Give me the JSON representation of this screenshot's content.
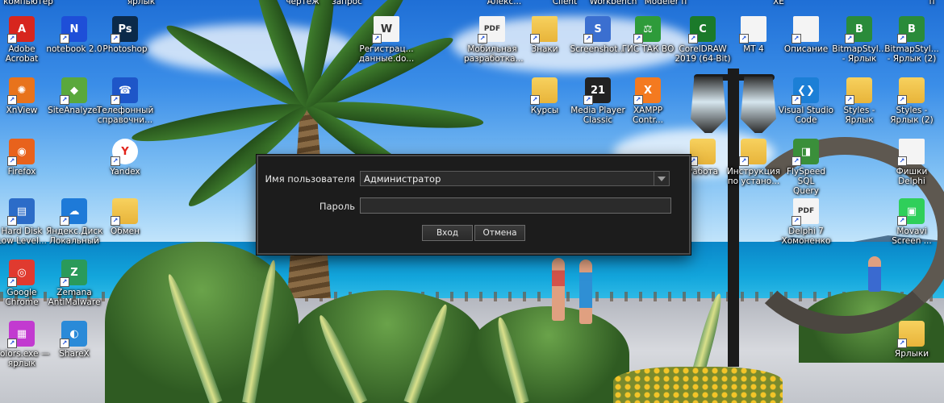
{
  "dialog": {
    "username_label": "Имя пользователя",
    "username_value": "Администратор",
    "password_label": "Пароль",
    "password_value": "",
    "ok_button": "Вход",
    "cancel_button": "Отмена"
  },
  "top_row_partial": [
    "компьютер",
    "ярлык",
    "чертеж",
    "запрос",
    "Алекс...",
    "Client",
    "Workbench",
    "Modeler п",
    "XE",
    "п"
  ],
  "desktop_icons": [
    {
      "label": "Adobe\nAcrobat",
      "icon": "adobe-acrobat-icon",
      "color": "#d7261e",
      "glyph": "A"
    },
    {
      "label": "notebook 2.0",
      "icon": "notebook-icon",
      "color": "#1e4fd8",
      "glyph": "N"
    },
    {
      "label": "Photoshop",
      "icon": "photoshop-icon",
      "color": "#0b2a4a",
      "glyph": "Ps"
    },
    {
      "label": "Регистрац...\nданные.do...",
      "icon": "word-document-icon",
      "color": "#f4f4f4",
      "glyph": "W"
    },
    {
      "label": "Мобильная\nразработка...",
      "icon": "pdf-document-icon",
      "color": "#f4f4f4",
      "glyph": "PDF"
    },
    {
      "label": "Знаки",
      "icon": "folder-icon",
      "color": "#f4f4f4",
      "glyph": ""
    },
    {
      "label": "Screenshot...",
      "icon": "screenshot-icon",
      "color": "#3b6fd0",
      "glyph": "S"
    },
    {
      "label": "ГИС ТАК ВО",
      "icon": "gis-icon",
      "color": "#2e9b3a",
      "glyph": "⚖"
    },
    {
      "label": "CorelDRAW\n2019 (64-Bit)",
      "icon": "coreldraw-icon",
      "color": "#1b7a2a",
      "glyph": "C"
    },
    {
      "label": "МТ 4",
      "icon": "document-icon",
      "color": "#f4f4f4",
      "glyph": ""
    },
    {
      "label": "Описание",
      "icon": "document-icon",
      "color": "#f4f4f4",
      "glyph": ""
    },
    {
      "label": "BitmapStyl...\n- Ярлык",
      "icon": "bitmapstyle-icon",
      "color": "#2a8b3a",
      "glyph": "B"
    },
    {
      "label": "BitmapStyl...\n- Ярлык (2)",
      "icon": "bitmapstyle-icon",
      "color": "#2a8b3a",
      "glyph": "B"
    },
    {
      "label": "XnView",
      "icon": "xnview-icon",
      "color": "#e8731c",
      "glyph": "✺"
    },
    {
      "label": "SiteAnalyzer",
      "icon": "siteanalyzer-icon",
      "color": "#5aa83c",
      "glyph": "◆"
    },
    {
      "label": "Телефонный\nсправочни...",
      "icon": "phone-book-icon",
      "color": "#1e56c8",
      "glyph": "☎"
    },
    {
      "label": "Курсы",
      "icon": "folder-icon",
      "color": "#f0c24a",
      "glyph": ""
    },
    {
      "label": "Media Player\nClassic",
      "icon": "media-player-icon",
      "color": "#222",
      "glyph": "21"
    },
    {
      "label": "XAMPP\nContr...",
      "icon": "xampp-icon",
      "color": "#f47a20",
      "glyph": "X"
    },
    {
      "label": "Visual Studio\nCode",
      "icon": "vscode-icon",
      "color": "#1c7fd6",
      "glyph": "❮❯"
    },
    {
      "label": "Styles -\nЯрлык",
      "icon": "folder-icon",
      "color": "#f0c24a",
      "glyph": ""
    },
    {
      "label": "Styles -\nЯрлык (2)",
      "icon": "folder-icon",
      "color": "#f0c24a",
      "glyph": ""
    },
    {
      "label": "Firefox",
      "icon": "firefox-icon",
      "color": "#e8621c",
      "glyph": "◉"
    },
    {
      "label": "Yandex",
      "icon": "yandex-icon",
      "color": "#ffffff",
      "glyph": "Y"
    },
    {
      "label": "Работа",
      "icon": "folder-icon",
      "color": "#f0c24a",
      "glyph": ""
    },
    {
      "label": "Инструкция\nпо устано...",
      "icon": "folder-icon",
      "color": "#f0c24a",
      "glyph": ""
    },
    {
      "label": "FlySpeed SQL\nQuery",
      "icon": "flyspeed-icon",
      "color": "#3a8f3a",
      "glyph": "◨"
    },
    {
      "label": "Фишки\nDelphi",
      "icon": "document-icon",
      "color": "#f4f4f4",
      "glyph": ""
    },
    {
      "label": "Hard Disk\nLow Level...",
      "icon": "hard-disk-icon",
      "color": "#2c6cc8",
      "glyph": "▤"
    },
    {
      "label": "Яндекс.Диск\nЛокальный",
      "icon": "yandex-disk-icon",
      "color": "#1e7ad8",
      "glyph": "☁"
    },
    {
      "label": "Обмен",
      "icon": "folder-icon",
      "color": "#f0c24a",
      "glyph": ""
    },
    {
      "label": "Delphi 7\nХомоненко",
      "icon": "pdf-document-icon",
      "color": "#f4f4f4",
      "glyph": "PDF"
    },
    {
      "label": "Movavi\nScreen ...",
      "icon": "movavi-icon",
      "color": "#2fcf5a",
      "glyph": "▣"
    },
    {
      "label": "Google\nChrome",
      "icon": "chrome-icon",
      "color": "#e03a2f",
      "glyph": "◎"
    },
    {
      "label": "Zemana\nAntiMalware",
      "icon": "zemana-icon",
      "color": "#2a9a5a",
      "glyph": "Z"
    },
    {
      "label": "Colors.exe —\nярлык",
      "icon": "colors-icon",
      "color": "#c23ad0",
      "glyph": "▦"
    },
    {
      "label": "ShareX",
      "icon": "sharex-icon",
      "color": "#2a8ad8",
      "glyph": "◐"
    },
    {
      "label": "Ярлыки",
      "icon": "folder-icon",
      "color": "#f0c24a",
      "glyph": ""
    }
  ]
}
